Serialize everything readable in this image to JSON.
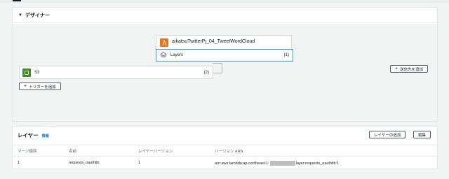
{
  "designer": {
    "title": "デザイナー",
    "function": {
      "name": "aikatsuTwitterPj_04_TweetWordCloud",
      "icon": "lambda-icon",
      "layers_label": "Layers",
      "layers_count": "(1)"
    },
    "trigger": {
      "name": "S3",
      "icon": "s3-bucket-icon",
      "count": "(2)"
    },
    "add_trigger_label": "トリガーを追加",
    "add_destination_label": "送信先を追加"
  },
  "layers": {
    "title": "レイヤー",
    "info_label": "情報",
    "add_layer_label": "レイヤーの追加",
    "edit_label": "編集",
    "columns": [
      "マージ順序",
      "名前",
      "レイヤーバージョン",
      "バージョン ARN"
    ],
    "rows": [
      {
        "merge_order": "1",
        "name": "requests_oauthlib",
        "version": "1",
        "arn_prefix": "arn:aws:lambda:ap-northeast-1:",
        "arn_suffix": "layer:requests_oauthlib:1"
      }
    ]
  },
  "colors": {
    "accent": "#0073bb",
    "lambda": "#e8741c",
    "s3": "#3f8624",
    "selected_border": "#2e9de0"
  }
}
